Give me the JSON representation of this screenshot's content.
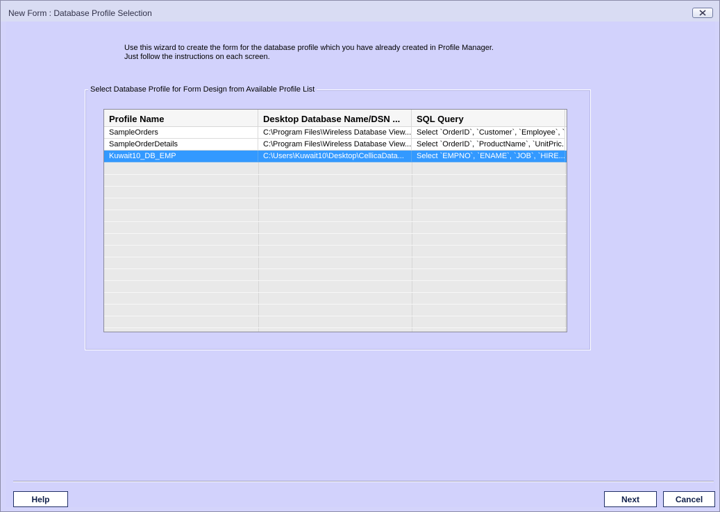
{
  "window": {
    "title": "New Form : Database Profile Selection"
  },
  "intro": {
    "line1": "Use this wizard to create the form for the database profile which you have already created in Profile Manager.",
    "line2": "Just follow the instructions on each screen."
  },
  "group": {
    "legend": "Select Database Profile for Form Design from Available Profile  List"
  },
  "grid": {
    "columns": [
      "Profile Name",
      "Desktop Database Name/DSN ...",
      "SQL Query"
    ],
    "rows": [
      [
        "SampleOrders",
        "C:\\Program Files\\Wireless Database View...",
        "Select `OrderID`, `Customer`, `Employee`, `..."
      ],
      [
        "SampleOrderDetails",
        "C:\\Program Files\\Wireless Database View...",
        "Select `OrderID`, `ProductName`, `UnitPric..."
      ],
      [
        "Kuwait10_DB_EMP",
        "C:\\Users\\Kuwait10\\Desktop\\CellicaData...",
        "Select `EMPNO`, `ENAME`, `JOB`, `HIRE..."
      ]
    ],
    "selected_row": 2
  },
  "buttons": {
    "help": "Help",
    "next": "Next",
    "cancel": "Cancel"
  },
  "colors": {
    "selection": "#3399ff",
    "background": "#d2d2fc"
  },
  "icons": {
    "close": "close-icon"
  }
}
